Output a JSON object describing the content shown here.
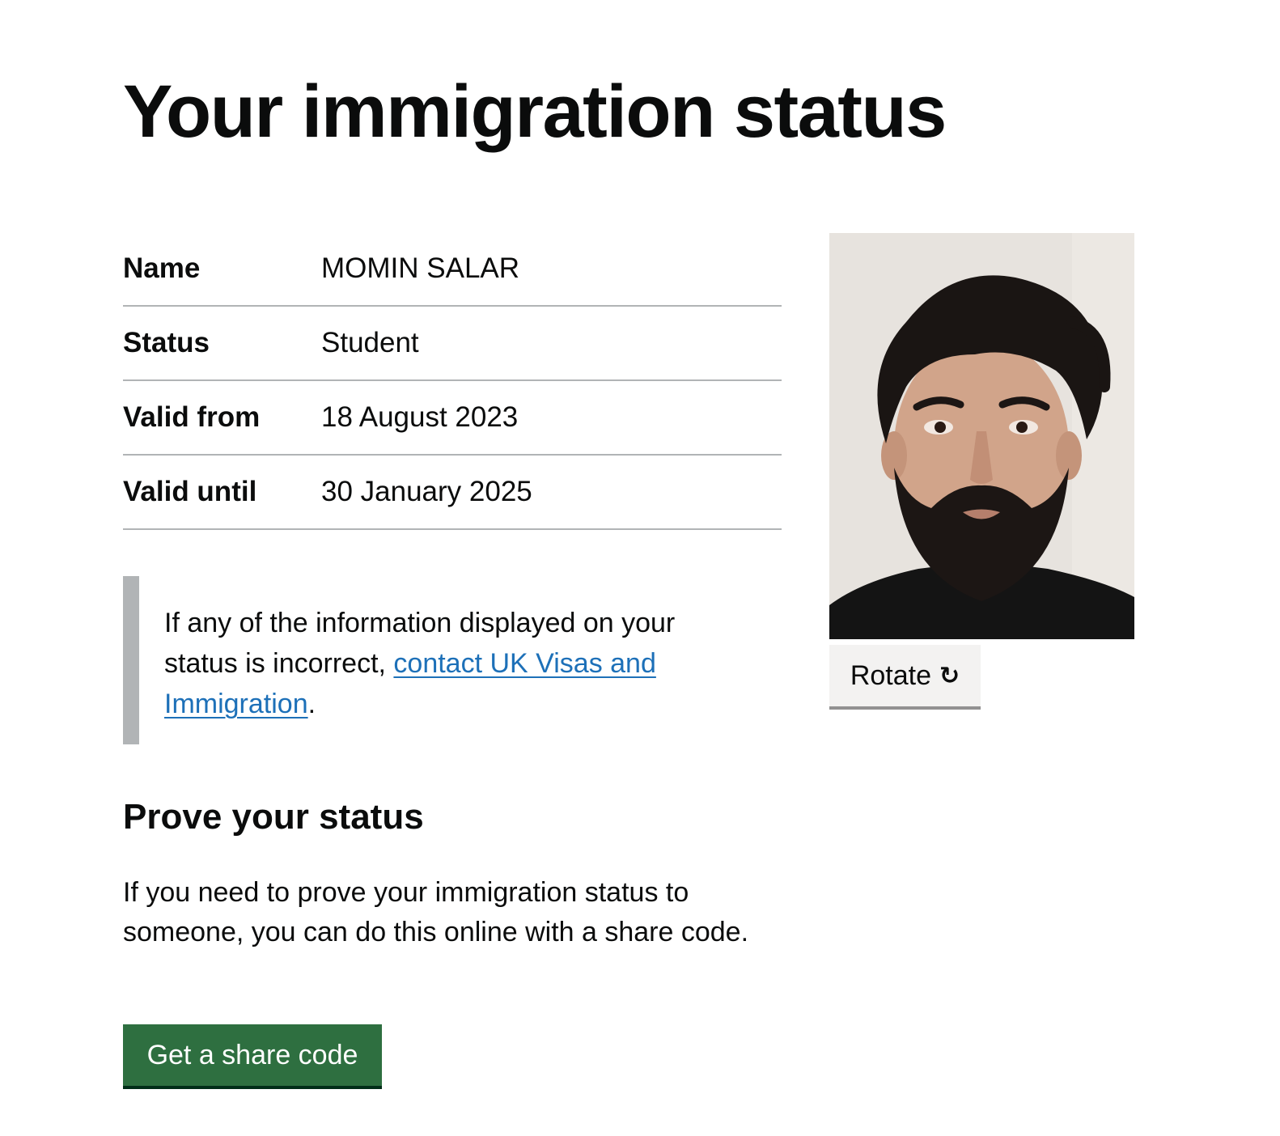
{
  "page": {
    "title": "Your immigration status"
  },
  "summary": {
    "rows": [
      {
        "key": "Name",
        "value": "MOMIN SALAR"
      },
      {
        "key": "Status",
        "value": "Student"
      },
      {
        "key": "Valid from",
        "value": "18 August 2023"
      },
      {
        "key": "Valid until",
        "value": "30 January 2025"
      }
    ]
  },
  "inset": {
    "text_before": "If any of the information displayed on your status is incorrect, ",
    "link_text": "contact UK Visas and Immigration",
    "text_after": "."
  },
  "photo": {
    "rotate_label": "Rotate",
    "rotate_icon": "↻"
  },
  "prove": {
    "heading": "Prove your status",
    "body": "If you need to prove your immigration status to someone, you can do this online with a share code.",
    "button_label": "Get a share code"
  },
  "colors": {
    "link": "#1d70b8",
    "primary_button": "#2e6f40",
    "inset_border": "#b1b4b6",
    "secondary_button": "#f3f2f1"
  }
}
